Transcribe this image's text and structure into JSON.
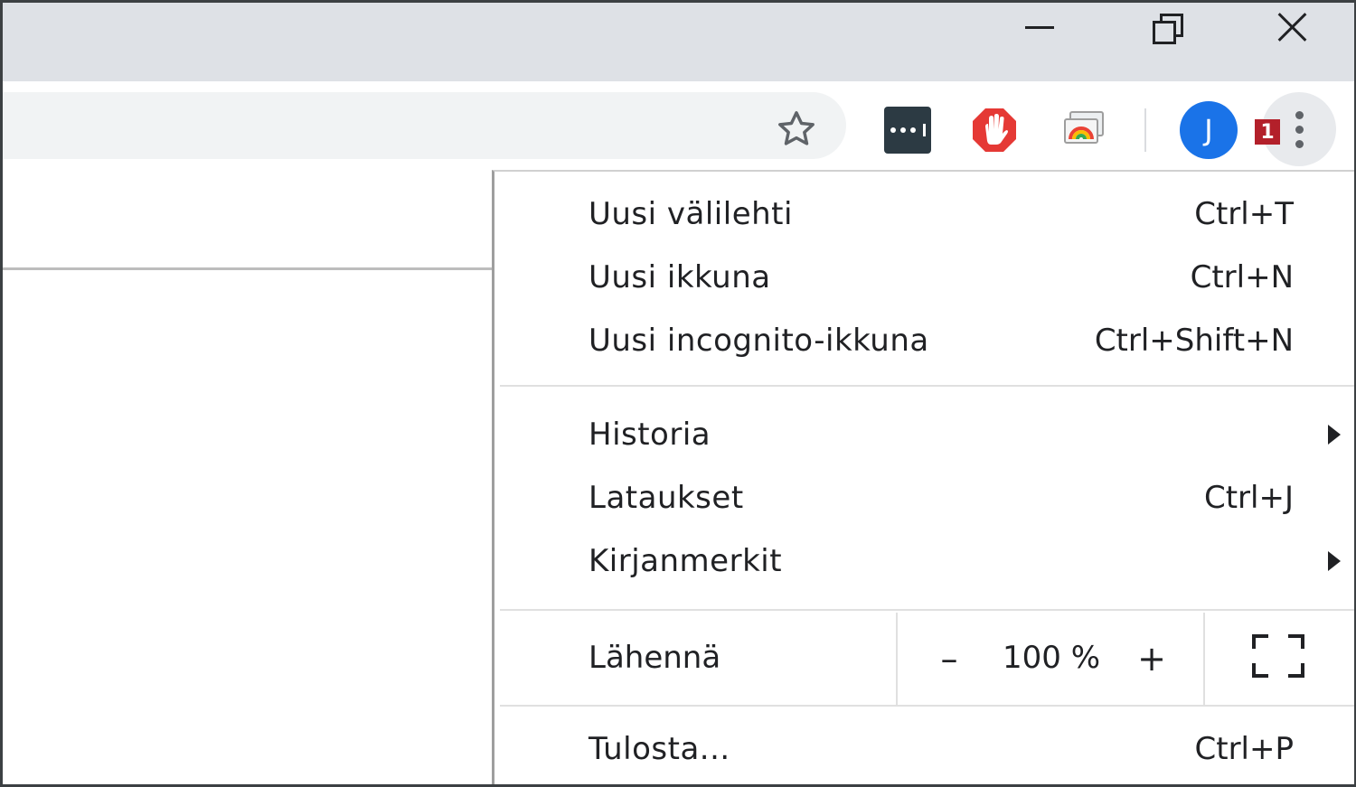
{
  "window_controls": {
    "minimize_icon": "minimize-icon",
    "maximize_icon": "restore-icon",
    "close_icon": "close-icon"
  },
  "toolbar": {
    "bookmark_icon": "star-icon",
    "extensions": [
      {
        "name": "lastpass-icon",
        "color": "#2c3a43"
      },
      {
        "name": "adblock-hand-icon",
        "color": "#e53935"
      },
      {
        "name": "cast-icon",
        "color": "#9e9e9e"
      }
    ],
    "avatar_initial": "J",
    "avatar_color": "#1a73e8",
    "notification_badge": "1",
    "badge_color": "#b3202a",
    "menu_icon": "more-vert-icon"
  },
  "menu": {
    "items_group1": [
      {
        "label": "Uusi välilehti",
        "shortcut": "Ctrl+T"
      },
      {
        "label": "Uusi ikkuna",
        "shortcut": "Ctrl+N"
      },
      {
        "label": "Uusi incognito-ikkuna",
        "shortcut": "Ctrl+Shift+N"
      }
    ],
    "items_group2": [
      {
        "label": "Historia",
        "submenu": true
      },
      {
        "label": "Lataukset",
        "shortcut": "Ctrl+J"
      },
      {
        "label": "Kirjanmerkit",
        "submenu": true
      }
    ],
    "zoom": {
      "label": "Lähennä",
      "decrease": "–",
      "value": "100 %",
      "increase": "+",
      "fullscreen_icon": "fullscreen-icon"
    },
    "items_group3": [
      {
        "label": "Tulosta...",
        "shortcut": "Ctrl+P"
      }
    ]
  }
}
